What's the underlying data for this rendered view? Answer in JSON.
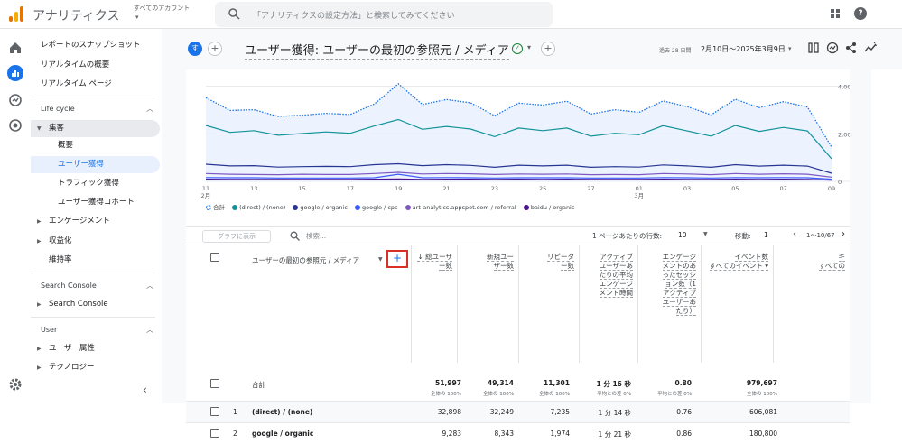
{
  "topbar": {
    "app_title": "アナリティクス",
    "account_label": "すべてのアカウント",
    "search_placeholder": "「アナリティクスの設定方法」と検索してみてください"
  },
  "nav": {
    "top_items": [
      "レポートのスナップショット",
      "リアルタイムの概要",
      "リアルタイム ページ"
    ],
    "lifecycle": {
      "title": "Life cycle",
      "group": "集客",
      "sub_items": [
        "概要",
        "ユーザー獲得",
        "トラフィック獲得",
        "ユーザー獲得コホート"
      ],
      "others": [
        "エンゲージメント",
        "収益化",
        "維持率"
      ]
    },
    "search_console": {
      "title": "Search Console",
      "item": "Search Console"
    },
    "user": {
      "title": "User",
      "items": [
        "ユーザー属性",
        "テクノロジー"
      ]
    }
  },
  "report": {
    "badge": "す",
    "title": "ユーザー獲得: ユーザーの最初の参照元 / メディア",
    "date_small": "過去 28 日間",
    "date_range": "2月10日～2025年3月9日"
  },
  "chart_data": {
    "type": "line",
    "x": [
      "11",
      "12",
      "13",
      "14",
      "15",
      "16",
      "17",
      "18",
      "19",
      "20",
      "21",
      "22",
      "23",
      "24",
      "25",
      "26",
      "27",
      "28",
      "01",
      "02",
      "03",
      "04",
      "05",
      "06",
      "07",
      "08",
      "09"
    ],
    "x_tick_labels": [
      "11",
      "13",
      "15",
      "17",
      "19",
      "21",
      "23",
      "25",
      "27",
      "01",
      "03",
      "05",
      "07",
      "09"
    ],
    "month_labels": [
      {
        "at": "11",
        "label": "2月"
      },
      {
        "at": "01",
        "label": "3月"
      }
    ],
    "ylim": [
      0,
      4400
    ],
    "y_ticks": [
      "4,000",
      "2,000",
      "0"
    ],
    "grid": true,
    "legend_position": "bottom-left",
    "series": [
      {
        "name": "合計",
        "color": "#1a73e8",
        "style": "dotted",
        "values": [
          3520,
          2980,
          3010,
          2730,
          2780,
          2860,
          2810,
          3250,
          4100,
          3230,
          3440,
          3300,
          2760,
          3290,
          3210,
          3370,
          2830,
          3010,
          2900,
          3380,
          3140,
          2800,
          3450,
          3100,
          3350,
          3120,
          1450
        ]
      },
      {
        "name": "(direct) / (none)",
        "color": "#12939a",
        "style": "solid",
        "values": [
          2350,
          2060,
          2130,
          1940,
          2010,
          2080,
          2020,
          2330,
          2600,
          2190,
          2310,
          2200,
          1880,
          2240,
          2130,
          2240,
          1900,
          2020,
          1960,
          2340,
          2120,
          1900,
          2350,
          2100,
          2270,
          2120,
          950
        ]
      },
      {
        "name": "google / organic",
        "color": "#283593",
        "style": "solid",
        "values": [
          720,
          650,
          660,
          600,
          620,
          630,
          620,
          700,
          740,
          660,
          700,
          670,
          590,
          680,
          650,
          680,
          590,
          620,
          600,
          690,
          650,
          590,
          700,
          640,
          680,
          640,
          340
        ]
      },
      {
        "name": "google / cpc",
        "color": "#3d5afe",
        "style": "solid",
        "values": [
          160,
          150,
          150,
          140,
          140,
          140,
          140,
          150,
          300,
          150,
          160,
          150,
          140,
          150,
          150,
          150,
          140,
          140,
          140,
          160,
          150,
          140,
          160,
          150,
          160,
          150,
          90
        ]
      },
      {
        "name": "art-analytics.appspot.com / referral",
        "color": "#7e57c2",
        "style": "solid",
        "values": [
          330,
          300,
          290,
          280,
          300,
          290,
          290,
          330,
          380,
          310,
          330,
          320,
          290,
          310,
          300,
          310,
          280,
          290,
          280,
          330,
          310,
          280,
          330,
          300,
          320,
          300,
          180
        ]
      },
      {
        "name": "baidu / organic",
        "color": "#4a148c",
        "style": "solid",
        "values": [
          90,
          80,
          80,
          80,
          80,
          80,
          80,
          90,
          100,
          80,
          90,
          90,
          80,
          90,
          80,
          90,
          80,
          80,
          80,
          90,
          80,
          80,
          90,
          80,
          90,
          80,
          50
        ]
      }
    ]
  },
  "table": {
    "graph_button": "グラフに表示",
    "search_placeholder": "検索...",
    "rows_per_page_label": "1 ページあたりの行数:",
    "rows_per_page": "10",
    "move_label": "移動:",
    "move_value": "1",
    "page_range": "1～10/67",
    "dimension_header": "ユーザーの最初の参照元 / メディア",
    "columns": [
      {
        "lines": [
          "↓ 総ユーザ",
          "ー数"
        ]
      },
      {
        "lines": [
          "新規ユー",
          "ザー数"
        ]
      },
      {
        "lines": [
          "リピータ",
          "ー数"
        ]
      },
      {
        "lines": [
          "アクティブ",
          "ユーザーあ",
          "たりの平均",
          "エンゲージ",
          "メント時間"
        ]
      },
      {
        "lines": [
          "エンゲージ",
          "メントのあ",
          "ったセッシ",
          "ョン数（1",
          "アクティブ",
          "ユーザーあ",
          "たり）"
        ]
      },
      {
        "lines": [
          "イベント数",
          "すべてのイベント ▾"
        ]
      },
      {
        "lines": [
          "キ",
          "すべての"
        ]
      }
    ],
    "total": {
      "label": "合計",
      "values": [
        "51,997",
        "49,314",
        "11,301",
        "1 分 16 秒",
        "0.80",
        "979,697"
      ],
      "subs": [
        "全体の 100%",
        "全体の 100%",
        "全体の 100%",
        "平均との差 0%",
        "平均との差 0%",
        "全体の 100%"
      ]
    },
    "rows": [
      {
        "index": "1",
        "name": "(direct) / (none)",
        "values": [
          "32,898",
          "32,249",
          "7,235",
          "1 分 14 秒",
          "0.76",
          "606,081"
        ]
      },
      {
        "index": "2",
        "name": "google / organic",
        "values": [
          "9,283",
          "8,343",
          "1,974",
          "1 分 21 秒",
          "0.86",
          "180,800"
        ]
      }
    ]
  }
}
